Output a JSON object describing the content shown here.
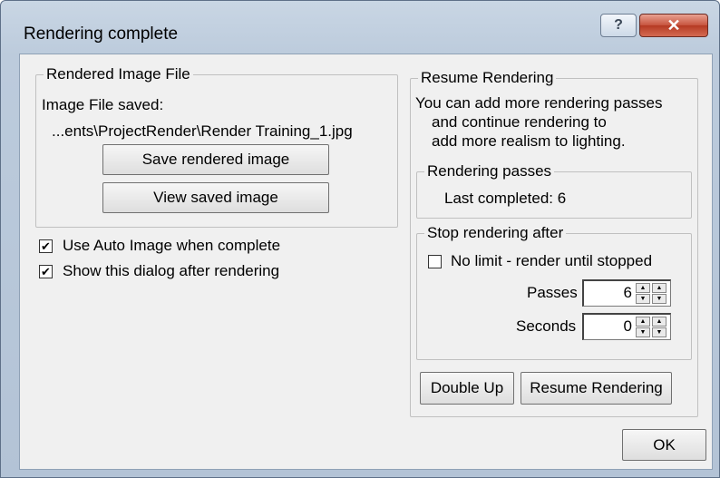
{
  "window": {
    "title": "Rendering complete",
    "help_label": "?",
    "close_label": "✕"
  },
  "rendered_file": {
    "group_label": "Rendered Image File",
    "saved_label": "Image File saved:",
    "path": "...ents\\ProjectRender\\Render Training_1.jpg",
    "save_button": "Save rendered image",
    "view_button": "View saved image"
  },
  "options": {
    "auto_image": {
      "label": "Use Auto Image when complete",
      "checked": true
    },
    "show_dialog": {
      "label": "Show this dialog after rendering",
      "checked": true
    }
  },
  "resume": {
    "group_label": "Resume Rendering",
    "description": [
      "You can add more rendering passes",
      "and continue rendering to",
      "add more realism to lighting."
    ],
    "passes_group_label": "Rendering passes",
    "last_completed": "Last completed: 6",
    "stop_group_label": "Stop rendering after",
    "no_limit": {
      "label": "No limit - render until stopped",
      "checked": false
    },
    "passes_label": "Passes",
    "passes_value": "6",
    "seconds_label": "Seconds",
    "seconds_value": "0",
    "double_up_button": "Double Up",
    "resume_button": "Resume Rendering"
  },
  "ok_button": "OK",
  "arrows": {
    "up": "▲",
    "down": "▼",
    "check": "✔"
  }
}
